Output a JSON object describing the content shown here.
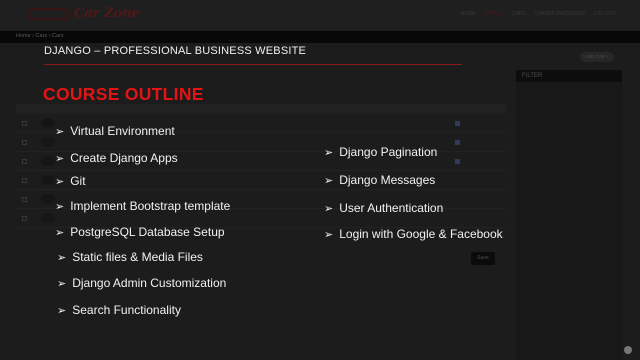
{
  "app": {
    "brand": "Car Zone",
    "top_links": [
      "HOME",
      "DETAILS",
      "CARS",
      "CHANGE PASSWORD",
      "LOG OUT"
    ],
    "breadcrumb": "Home › Cars › Cars"
  },
  "background_page": {
    "save_label": "Save",
    "add_label": "ADD CAR +",
    "filter_title": "FILTER"
  },
  "slide": {
    "title": "DJANGO – PROFESSIONAL BUSINESS WEBSITE",
    "heading": "COURSE OUTLINE",
    "arrow_glyph": "➢",
    "left_topics": [
      "Virtual Environment",
      "Create Django Apps",
      "Git",
      "Implement Bootstrap template",
      "PostgreSQL Database Setup",
      "Static files & Media Files",
      "Django Admin Customization",
      "Search Functionality"
    ],
    "right_topics": [
      "Django Pagination",
      "Django Messages",
      "User Authentication",
      "Login with Google & Facebook"
    ]
  },
  "colors": {
    "heading_red": "#e31414",
    "rule_red": "#8a1a1a",
    "text": "#f2f2f2"
  }
}
